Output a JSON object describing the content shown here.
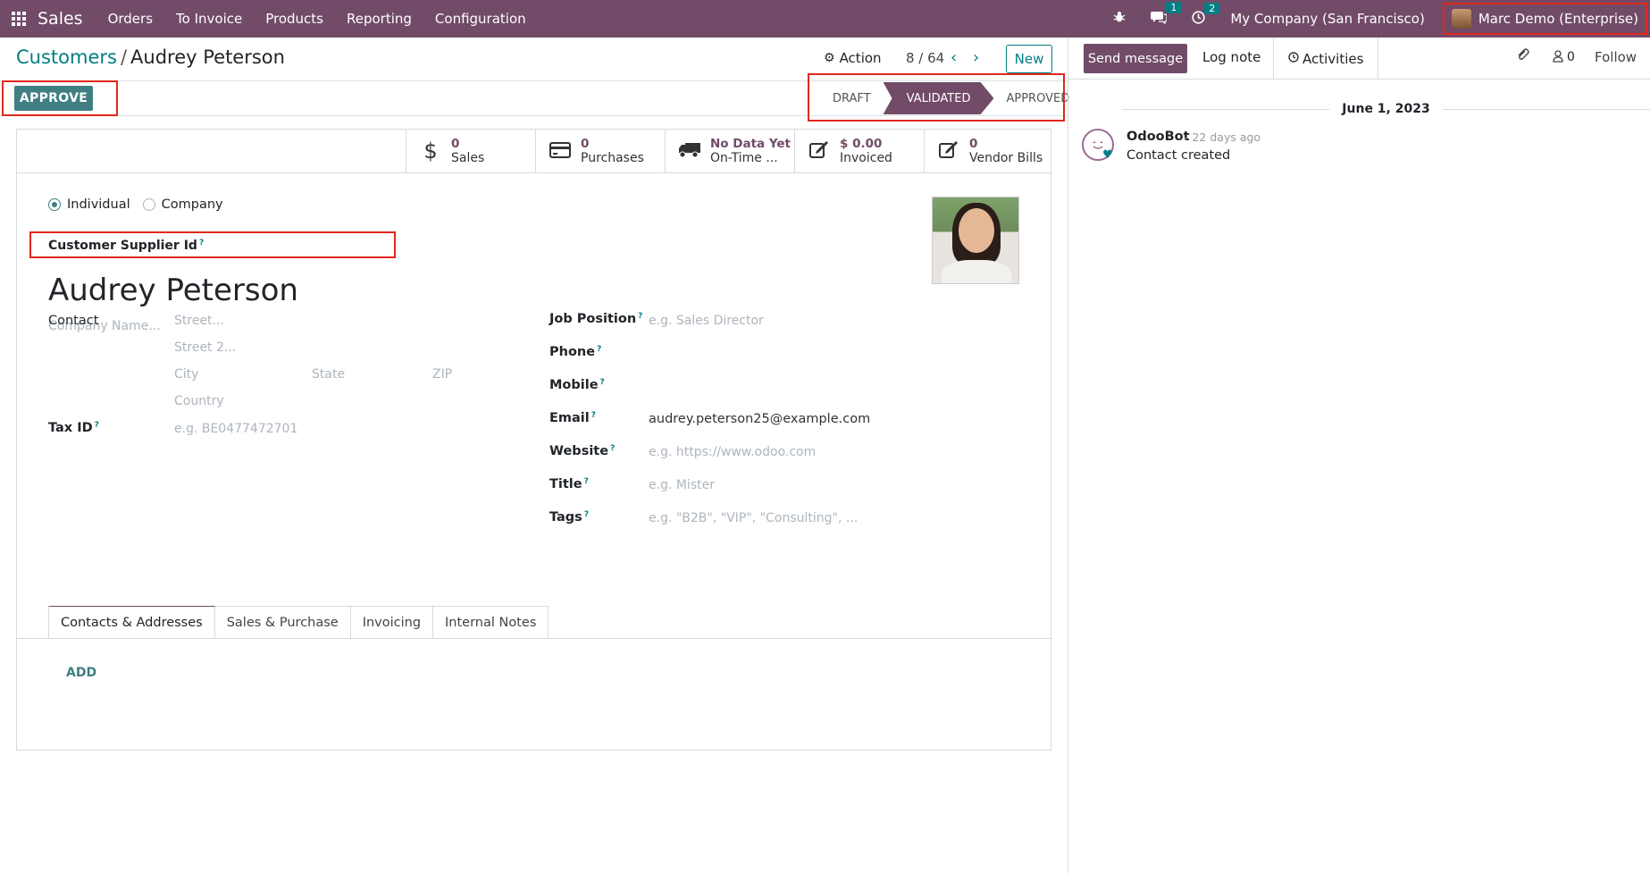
{
  "navbar": {
    "brand": "Sales",
    "menu": [
      "Orders",
      "To Invoice",
      "Products",
      "Reporting",
      "Configuration"
    ],
    "messages_count": "1",
    "activities_count": "2",
    "company": "My Company (San Francisco)",
    "user": "Marc Demo (Enterprise)",
    "accent_color": "#714b67"
  },
  "control_panel": {
    "breadcrumb_parent": "Customers",
    "breadcrumb_separator": "/",
    "breadcrumb_current": "Audrey Peterson",
    "action_label": "Action",
    "pager": "8 / 64",
    "new_label": "New",
    "approve_label": "APPROVE",
    "status_steps": [
      "DRAFT",
      "VALIDATED",
      "APPROVED"
    ],
    "active_status": "VALIDATED"
  },
  "stat_buttons": [
    {
      "value": "0",
      "label": "Sales",
      "icon": "dollar-icon"
    },
    {
      "value": "0",
      "label": "Purchases",
      "icon": "credit-card-icon"
    },
    {
      "value": "No Data Yet",
      "label": "On-Time ...",
      "icon": "truck-icon"
    },
    {
      "value": "$ 0.00",
      "label": "Invoiced",
      "icon": "edit-icon"
    },
    {
      "value": "0",
      "label": "Vendor Bills",
      "icon": "edit-icon"
    }
  ],
  "form": {
    "type_options": [
      "Individual",
      "Company"
    ],
    "type_selected": "Individual",
    "supplier_id_label": "Customer Supplier Id",
    "help_mark": "?",
    "name": "Audrey Peterson",
    "company_placeholder": "Company Name...",
    "contact_label": "Contact",
    "street_placeholder": "Street...",
    "street2_placeholder": "Street 2...",
    "city_placeholder": "City",
    "state_placeholder": "State",
    "zip_placeholder": "ZIP",
    "country_placeholder": "Country",
    "tax_id_label": "Tax ID",
    "tax_id_placeholder": "e.g. BE0477472701",
    "job_position_label": "Job Position",
    "job_position_placeholder": "e.g. Sales Director",
    "phone_label": "Phone",
    "mobile_label": "Mobile",
    "email_label": "Email",
    "email_value": "audrey.peterson25@example.com",
    "website_label": "Website",
    "website_placeholder": "e.g. https://www.odoo.com",
    "title_label": "Title",
    "title_placeholder": "e.g. Mister",
    "tags_label": "Tags",
    "tags_placeholder": "e.g. \"B2B\", \"VIP\", \"Consulting\", ..."
  },
  "tabs": [
    "Contacts & Addresses",
    "Sales & Purchase",
    "Invoicing",
    "Internal Notes"
  ],
  "tab_active": "Contacts & Addresses",
  "add_label": "ADD",
  "chatter": {
    "send_message": "Send message",
    "log_note": "Log note",
    "activities": "Activities",
    "followers_count": "0",
    "follow": "Follow",
    "date": "June 1, 2023",
    "message": {
      "author": "OdooBot",
      "time": "- 22 days ago",
      "body": "Contact created"
    }
  }
}
